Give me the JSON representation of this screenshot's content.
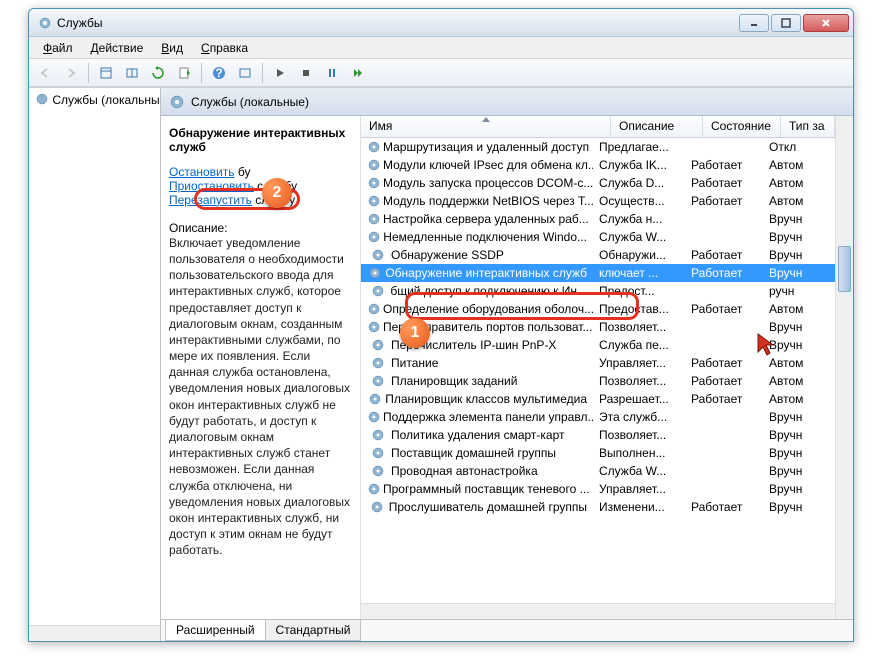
{
  "window": {
    "title": "Службы"
  },
  "menu": {
    "file": "Файл",
    "action": "Действие",
    "view": "Вид",
    "help": "Справка"
  },
  "header": {
    "label": "Службы (локальные)"
  },
  "tree": {
    "item": "Службы (локальны"
  },
  "desc": {
    "title": "Обнаружение интерактивных служб",
    "stop": "Остановить",
    "stop_suffix": " бу",
    "pause": "Приостановить",
    "pause_suffix": " службу",
    "restart": "Перезапустить",
    "restart_suffix": " службу",
    "label": "Описание:",
    "text": "Включает уведомление пользователя о необходимости пользовательского ввода для интерактивных служб, которое предоставляет доступ к диалоговым окнам, созданным интерактивными службами, по мере их появления. Если данная служба остановлена, уведомления новых диалоговых окон интерактивных служб не будут работать, и доступ к диалоговым окнам интерактивных служб станет невозможен. Если данная служба отключена, ни уведомления новых диалоговых окон интерактивных служб, ни доступ к этим окнам не будут работать."
  },
  "columns": {
    "name": "Имя",
    "desc": "Описание",
    "state": "Состояние",
    "type": "Тип за"
  },
  "services": [
    {
      "name": "Маршрутизация и удаленный доступ",
      "desc": "Предлагае...",
      "state": "",
      "type": "Откл"
    },
    {
      "name": "Модули ключей IPsec для обмена кл...",
      "desc": "Служба IK...",
      "state": "Работает",
      "type": "Автом"
    },
    {
      "name": "Модуль запуска процессов DCOM-с...",
      "desc": "Служба D...",
      "state": "Работает",
      "type": "Автом"
    },
    {
      "name": "Модуль поддержки NetBIOS через T...",
      "desc": "Осуществ...",
      "state": "Работает",
      "type": "Автом"
    },
    {
      "name": "Настройка сервера удаленных раб...",
      "desc": "Служба н...",
      "state": "",
      "type": "Вручн"
    },
    {
      "name": "Немедленные подключения Windo...",
      "desc": "Служба W...",
      "state": "",
      "type": "Вручн"
    },
    {
      "name": "Обнаружение SSDP",
      "desc": "Обнаружи...",
      "state": "Работает",
      "type": "Вручн"
    },
    {
      "name": "Обнаружение интерактивных служб",
      "desc": "ключает ...",
      "state": "Работает",
      "type": "Вручн",
      "selected": true
    },
    {
      "name": "бщий доступ к подключению к Ин...",
      "desc": "Предост...",
      "state": "",
      "type": "ручн"
    },
    {
      "name": "Определение оборудования оболоч...",
      "desc": "Предостав...",
      "state": "Работает",
      "type": "Автом"
    },
    {
      "name": "Перенаправитель портов пользоват...",
      "desc": "Позволяет...",
      "state": "",
      "type": "Вручн"
    },
    {
      "name": "Перечислитель IP-шин PnP-X",
      "desc": "Служба пе...",
      "state": "",
      "type": "Вручн"
    },
    {
      "name": "Питание",
      "desc": "Управляет...",
      "state": "Работает",
      "type": "Автом"
    },
    {
      "name": "Планировщик заданий",
      "desc": "Позволяет...",
      "state": "Работает",
      "type": "Автом"
    },
    {
      "name": "Планировщик классов мультимедиа",
      "desc": "Разрешает...",
      "state": "Работает",
      "type": "Автом"
    },
    {
      "name": "Поддержка элемента панели управл...",
      "desc": "Эта служб...",
      "state": "",
      "type": "Вручн"
    },
    {
      "name": "Политика удаления смарт-карт",
      "desc": "Позволяет...",
      "state": "",
      "type": "Вручн"
    },
    {
      "name": "Поставщик домашней группы",
      "desc": "Выполнен...",
      "state": "",
      "type": "Вручн"
    },
    {
      "name": "Проводная автонастройка",
      "desc": "Служба W...",
      "state": "",
      "type": "Вручн"
    },
    {
      "name": "Программный поставщик теневого ...",
      "desc": "Управляет...",
      "state": "",
      "type": "Вручн"
    },
    {
      "name": "Прослушиватель домашней группы",
      "desc": "Изменени...",
      "state": "Работает",
      "type": "Вручн"
    }
  ],
  "tabs": {
    "ext": "Расширенный",
    "std": "Стандартный"
  },
  "badges": {
    "b1": "1",
    "b2": "2"
  }
}
